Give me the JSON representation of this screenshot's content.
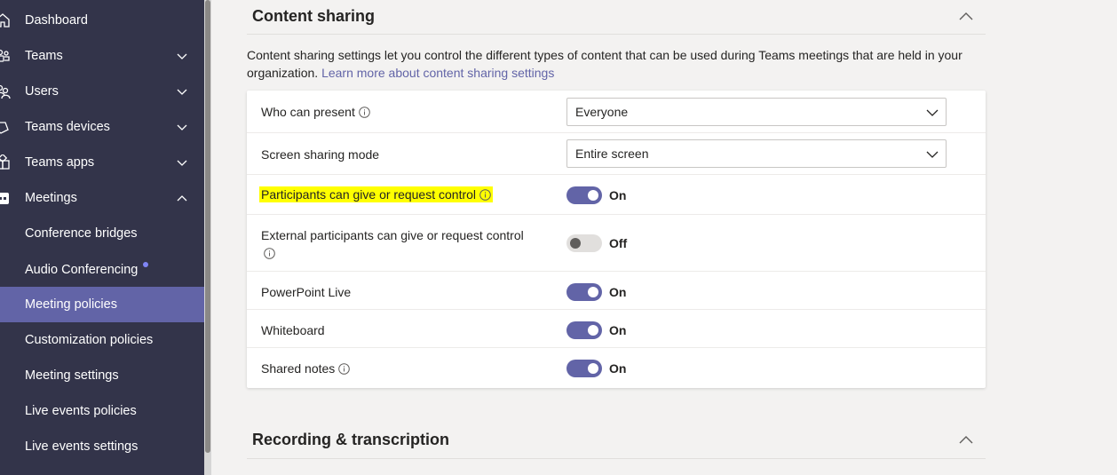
{
  "sidebar": {
    "items": [
      {
        "label": "Dashboard",
        "icon": "home-icon"
      },
      {
        "label": "Teams",
        "icon": "teams-icon"
      },
      {
        "label": "Users",
        "icon": "users-icon"
      },
      {
        "label": "Teams devices",
        "icon": "devices-icon"
      },
      {
        "label": "Teams apps",
        "icon": "apps-icon"
      },
      {
        "label": "Meetings",
        "icon": "meetings-icon"
      },
      {
        "label": "Conference bridges"
      },
      {
        "label": "Audio Conferencing"
      },
      {
        "label": "Meeting policies",
        "active": true
      },
      {
        "label": "Customization policies"
      },
      {
        "label": "Meeting settings"
      },
      {
        "label": "Live events policies"
      },
      {
        "label": "Live events settings"
      }
    ]
  },
  "content_sharing": {
    "title": "Content sharing",
    "description": "Content sharing settings let you control the different types of content that can be used during Teams meetings that are held in your organization.",
    "learn_more": "Learn more about content sharing settings",
    "settings": [
      {
        "label": "Who can present",
        "type": "dropdown",
        "value": "Everyone"
      },
      {
        "label": "Screen sharing mode",
        "type": "dropdown",
        "value": "Entire screen"
      },
      {
        "label": "Participants can give or request control",
        "type": "toggle",
        "state": "On",
        "on": true
      },
      {
        "label": "External participants can give or request control",
        "type": "toggle",
        "state": "Off",
        "on": false
      },
      {
        "label": "PowerPoint Live",
        "type": "toggle",
        "state": "On",
        "on": true
      },
      {
        "label": "Whiteboard",
        "type": "toggle",
        "state": "On",
        "on": true
      },
      {
        "label": "Shared notes",
        "type": "toggle",
        "state": "On",
        "on": true
      }
    ]
  },
  "recording": {
    "title": "Recording & transcription"
  },
  "colors": {
    "sidebar_bg": "#33344a",
    "accent": "#6264a7",
    "highlight": "#ffff00"
  }
}
